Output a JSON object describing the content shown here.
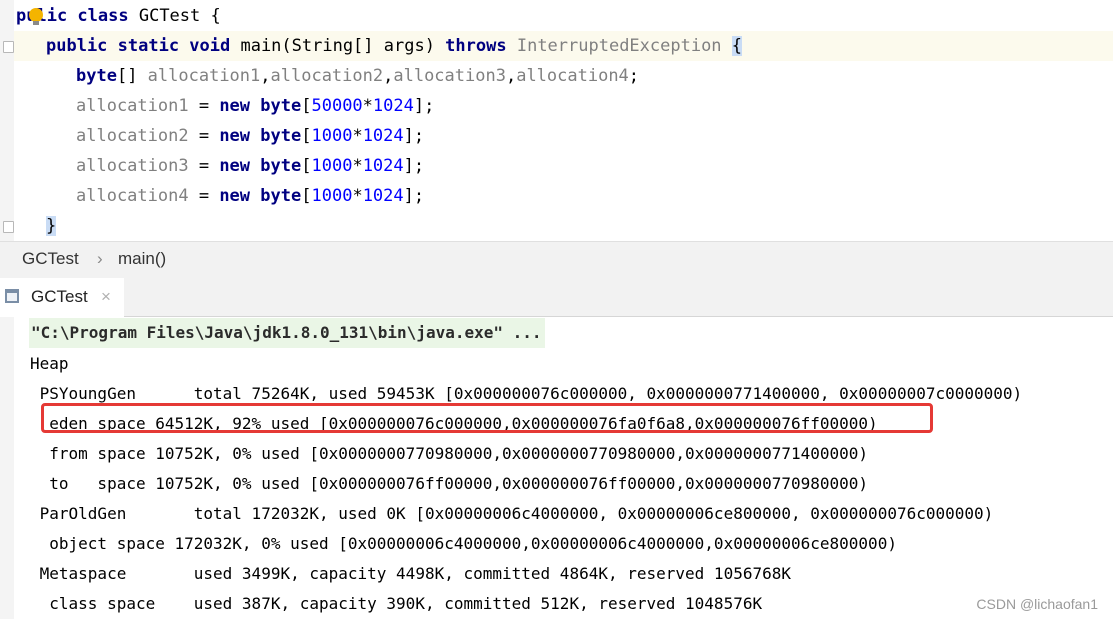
{
  "editor": {
    "class_line": {
      "kw_part1": "pu",
      "kw_part2": "lic class",
      "name": " GCTest {"
    },
    "main_line": {
      "mods": "public static void",
      "sig": " main(String[] args) ",
      "throws_kw": "throws",
      "exception": "InterruptedException",
      "brace": "{"
    },
    "decl_line": {
      "type": "byte",
      "rest_a": "[] ",
      "vars": "allocation1",
      "c1": ",",
      "v2": "allocation2",
      "c2": ",",
      "v3": "allocation3",
      "c3": ",",
      "v4": "allocation4",
      "end": ";"
    },
    "assignments": [
      {
        "var": "allocation1",
        "eq": " = ",
        "new_kw": "new",
        "type": "byte",
        "open": "[",
        "n1": "50000",
        "times": "*",
        "n2": "1024",
        "close": "];"
      },
      {
        "var": "allocation2",
        "eq": " = ",
        "new_kw": "new",
        "type": "byte",
        "open": "[",
        "n1": "1000",
        "times": "*",
        "n2": "1024",
        "close": "];"
      },
      {
        "var": "allocation3",
        "eq": " = ",
        "new_kw": "new",
        "type": "byte",
        "open": "[",
        "n1": "1000",
        "times": "*",
        "n2": "1024",
        "close": "];"
      },
      {
        "var": "allocation4",
        "eq": " = ",
        "new_kw": "new",
        "type": "byte",
        "open": "[",
        "n1": "1000",
        "times": "*",
        "n2": "1024",
        "close": "];"
      }
    ],
    "close_brace": "}"
  },
  "breadcrumb": {
    "class": "GCTest",
    "sep": "›",
    "method": "main()"
  },
  "run_tab": {
    "label": "GCTest",
    "close": "×"
  },
  "console": {
    "lines": [
      "\"C:\\Program Files\\Java\\jdk1.8.0_131\\bin\\java.exe\" ...",
      "Heap",
      " PSYoungGen      total 75264K, used 59453K [0x000000076c000000, 0x0000000771400000, 0x00000007c0000000)",
      "  eden space 64512K, 92% used [0x000000076c000000,0x000000076fa0f6a8,0x000000076ff00000)",
      "  from space 10752K, 0% used [0x0000000770980000,0x0000000770980000,0x0000000771400000)",
      "  to   space 10752K, 0% used [0x000000076ff00000,0x000000076ff00000,0x0000000770980000)",
      " ParOldGen       total 172032K, used 0K [0x00000006c4000000, 0x00000006ce800000, 0x000000076c000000)",
      "  object space 172032K, 0% used [0x00000006c4000000,0x00000006c4000000,0x00000006ce800000)",
      " Metaspace       used 3499K, capacity 4498K, committed 4864K, reserved 1056768K",
      "  class space    used 387K, capacity 390K, committed 512K, reserved 1048576K"
    ]
  },
  "watermark": "CSDN @lichaofan1",
  "colors": {
    "keyword": "#000080",
    "number": "#0000ff",
    "variable": "#808080",
    "highlight_box": "#e53935"
  }
}
